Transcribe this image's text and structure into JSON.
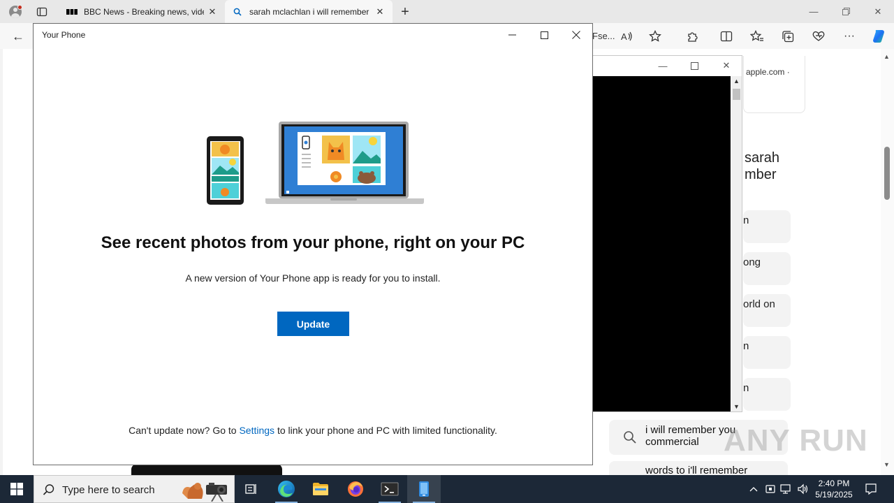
{
  "browser": {
    "tabs": [
      {
        "title": "BBC News - Breaking news, video"
      },
      {
        "title": "sarah mclachlan i will remember"
      }
    ],
    "address_fragment": "Fse...",
    "page": {
      "card_top_text": "apple.com ·",
      "heading_lines": [
        "sarah",
        "mber"
      ],
      "pills": [
        "n",
        "ong",
        "orld on",
        "n",
        "n"
      ],
      "suggestion": "i will remember you commercial",
      "suggestion2": "words to i'll remember"
    },
    "watermark": "ANY RUN"
  },
  "your_phone": {
    "window_title": "Your Phone",
    "heading": "See recent photos from your phone, right on your PC",
    "subtitle": "A new version of Your Phone app is ready for you to install.",
    "update_label": "Update",
    "footer_before": "Can't update now? Go to ",
    "footer_link": "Settings",
    "footer_after": " to link your phone and PC with limited functionality."
  },
  "taskbar": {
    "search_placeholder": "Type here to search",
    "time": "2:40 PM",
    "date": "5/19/2025"
  },
  "colors": {
    "accent": "#0067c0",
    "taskbar": "#1c2837"
  }
}
